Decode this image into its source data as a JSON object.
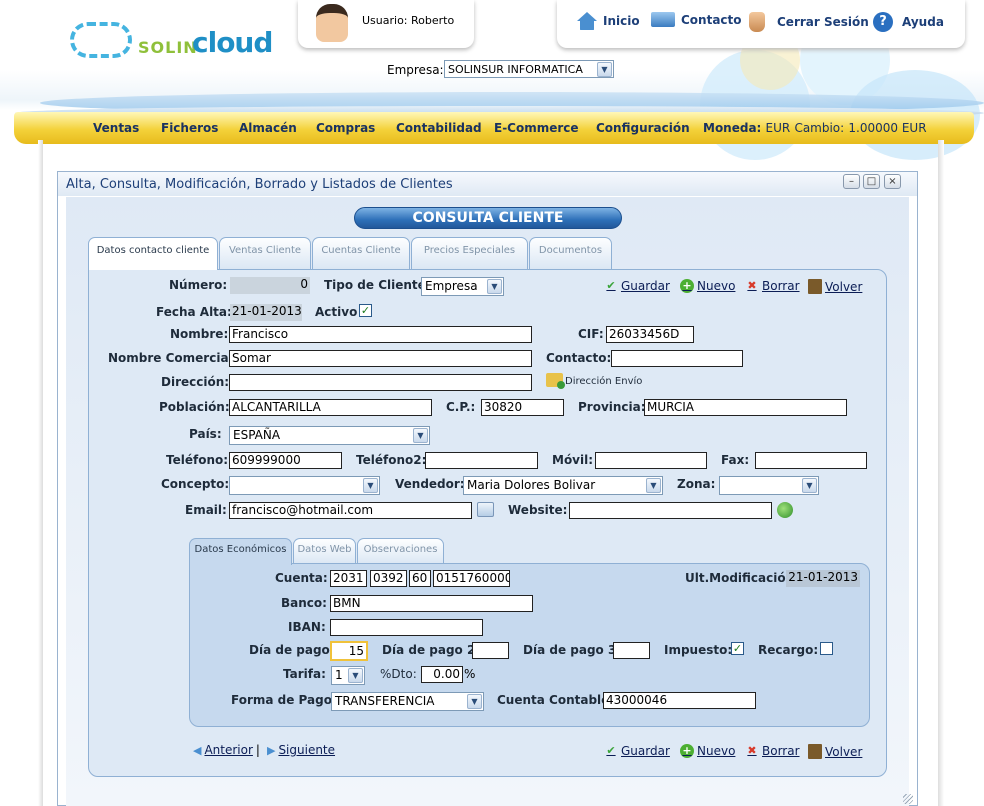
{
  "header": {
    "logo_prefix": "SOLIN",
    "logo_main": "cloud",
    "user_label": "Usuario:",
    "user_name": "Roberto",
    "empresa_label": "Empresa:",
    "empresa_value": "SOLINSUR INFORMATICA",
    "nav": [
      {
        "label": "Inicio",
        "icon": "home-icon"
      },
      {
        "label": "Contacto",
        "icon": "mail-icon"
      },
      {
        "label": "Cerrar Sesión",
        "icon": "lock-icon"
      },
      {
        "label": "Ayuda",
        "icon": "help-icon"
      }
    ]
  },
  "menu": {
    "items": [
      "Ventas",
      "Ficheros",
      "Almacén",
      "Compras",
      "Contabilidad",
      "E-Commerce",
      "Configuración"
    ],
    "moneda_label": "Moneda:",
    "moneda_value": "EUR",
    "cambio_label": "Cambio:",
    "cambio_value": "1.00000 EUR"
  },
  "window": {
    "title": "Alta, Consulta, Modificación, Borrado y Listados de Clientes",
    "heading": "CONSULTA CLIENTE",
    "tabs": [
      "Datos contacto cliente",
      "Ventas Cliente",
      "Cuentas Cliente",
      "Precios Especiales",
      "Documentos"
    ],
    "actions": {
      "guardar": "Guardar",
      "nuevo": "Nuevo",
      "borrar": "Borrar",
      "volver": "Volver"
    }
  },
  "form": {
    "numero_label": "Número:",
    "numero": "0",
    "tipo_label": "Tipo de Cliente:",
    "tipo": "Empresa",
    "fecha_alta_label": "Fecha Alta:",
    "fecha_alta": "21-01-2013",
    "activo_label": "Activo",
    "activo": true,
    "nombre_label": "Nombre:",
    "nombre": "Francisco",
    "cif_label": "CIF:",
    "cif": "26033456D",
    "nombre_comercial_label": "Nombre Comercial:",
    "nombre_comercial": "Somar",
    "contacto_label": "Contacto:",
    "contacto": "",
    "direccion_label": "Dirección:",
    "direccion": "",
    "direccion_envio": "Dirección Envío",
    "poblacion_label": "Población:",
    "poblacion": "ALCANTARILLA",
    "cp_label": "C.P.:",
    "cp": "30820",
    "provincia_label": "Provincia:",
    "provincia": "MURCIA",
    "pais_label": "País:",
    "pais": "ESPAÑA",
    "telefono_label": "Teléfono:",
    "telefono": "609999000",
    "telefono2_label": "Teléfono2:",
    "telefono2": "",
    "movil_label": "Móvil:",
    "movil": "",
    "fax_label": "Fax:",
    "fax": "",
    "concepto_label": "Concepto:",
    "concepto": "",
    "vendedor_label": "Vendedor:",
    "vendedor": "Maria Dolores Bolivar",
    "zona_label": "Zona:",
    "zona": "",
    "email_label": "Email:",
    "email": "francisco@hotmail.com",
    "website_label": "Website:",
    "website": ""
  },
  "economicos": {
    "tabs": [
      "Datos Económicos",
      "Datos Web",
      "Observaciones"
    ],
    "cuenta_label": "Cuenta:",
    "cuenta": [
      "2031",
      "0392",
      "60",
      "0151760000"
    ],
    "ult_mod_label": "Ult.Modificación:",
    "ult_mod": "21-01-2013",
    "banco_label": "Banco:",
    "banco": "BMN",
    "iban_label": "IBAN:",
    "iban": "",
    "dia_pago_label": "Día de pago:",
    "dia_pago": "15",
    "dia_pago2_label": "Día de pago 2:",
    "dia_pago2": "",
    "dia_pago3_label": "Día de pago 3:",
    "dia_pago3": "",
    "impuesto_label": "Impuesto:",
    "impuesto": true,
    "recargo_label": "Recargo:",
    "recargo": false,
    "tarifa_label": "Tarifa:",
    "tarifa": "1",
    "dto_label": "%Dto:",
    "dto": "0.00",
    "dto_unit": "%",
    "forma_pago_label": "Forma de Pago:",
    "forma_pago": "TRANSFERENCIA",
    "cuenta_contable_label": "Cuenta Contable:",
    "cuenta_contable": "43000046"
  },
  "pager": {
    "anterior": "Anterior",
    "separator": "|",
    "siguiente": "Siguiente"
  },
  "colors": {
    "accent": "#1d3f78",
    "menu_bar": "#f4d23a",
    "panel": "#dee9f5",
    "subpanel": "#c6d9ee"
  }
}
